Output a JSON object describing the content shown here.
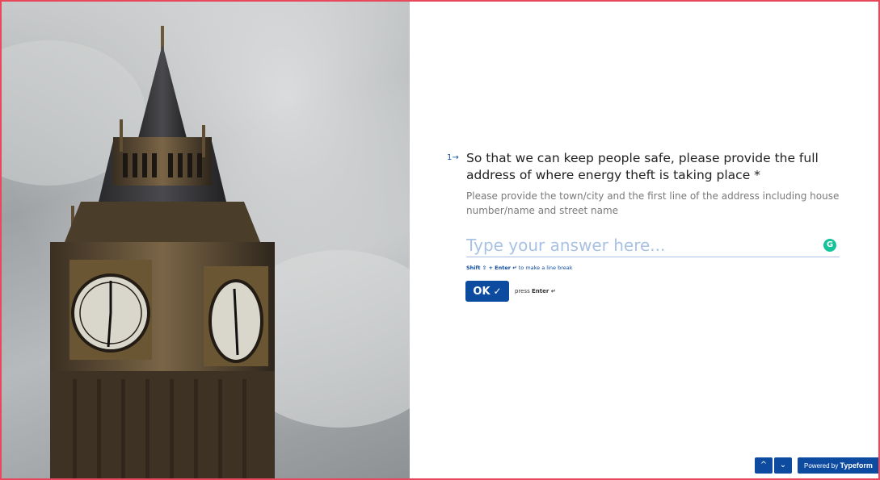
{
  "question": {
    "number": "1",
    "text": "So that we can keep people safe, please provide the full address of where energy theft is taking place *",
    "description": "Please provide the town/city and the first line of the address including house number/name and street name"
  },
  "answer": {
    "placeholder": "Type your answer here...",
    "value": ""
  },
  "hint": {
    "keys": "Shift ⇧ + Enter ↵",
    "text": "to make a line break"
  },
  "ok_button": {
    "label": "OK",
    "check": "✓"
  },
  "press_enter": {
    "prefix": "press",
    "key": "Enter ↵"
  },
  "navigation": {
    "up": "^",
    "down": "⌄"
  },
  "powered": {
    "prefix": "Powered by",
    "brand": "Typeform"
  },
  "colors": {
    "accent": "#0d4ba0",
    "border": "#e8485b",
    "placeholder": "#a9c1e3"
  },
  "icons": {
    "grammarly": "grammarly-icon",
    "arrow": "arrow-right-icon"
  }
}
